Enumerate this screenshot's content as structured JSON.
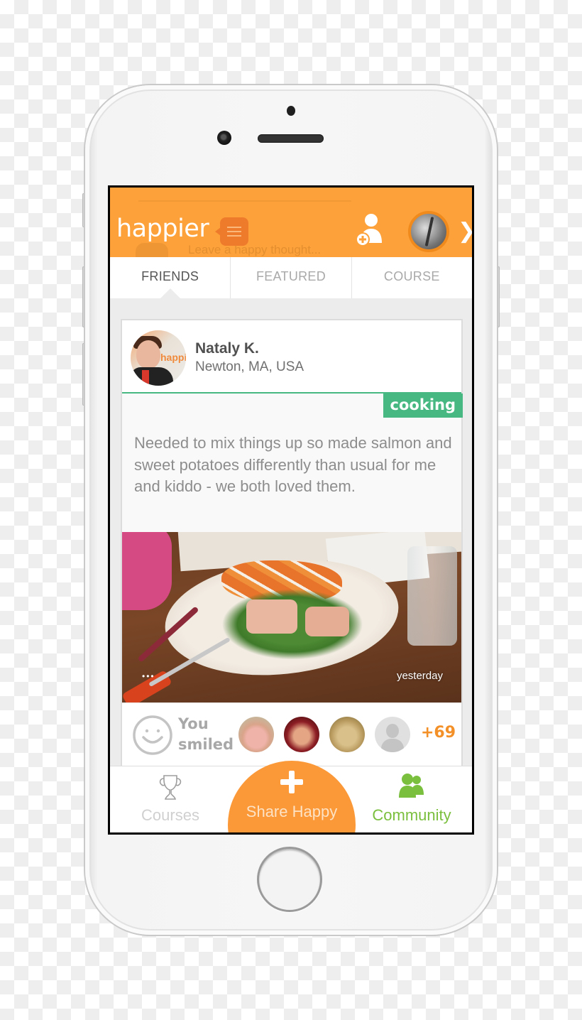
{
  "app": {
    "logo": "happier",
    "compose_placeholder": "Leave a happy thought...",
    "brand_color": "#fda23a",
    "accent_green": "#47b881",
    "community_green": "#7bbf3e"
  },
  "header": {
    "icons": {
      "menu": "menu-lines-icon",
      "add_friend": "add-friend-icon",
      "profile": "profile-avatar",
      "next": "chevron-right-icon"
    },
    "next_glyph": "❯"
  },
  "tabs": [
    {
      "label": "FRIENDS",
      "active": true
    },
    {
      "label": "FEATURED",
      "active": false
    },
    {
      "label": "COURSE",
      "active": false
    }
  ],
  "post": {
    "author": {
      "name": "Nataly K.",
      "location": "Newton, MA, USA",
      "avatar_brand_text": "happi"
    },
    "tag": "cooking",
    "text": "Needed to mix things up so made salmon and sweet potatoes differently than usual for me and kiddo - we both loved them.",
    "photo_alt": "salmon and sweet potatoes on a plate with arugula",
    "more_dots": "•••",
    "timestamp": "yesterday",
    "reactions": {
      "status_line1": "You",
      "status_line2": "smiled",
      "likers": [
        "friend-1",
        "friend-2",
        "friend-3",
        "friend-placeholder"
      ],
      "more_count": "+69"
    }
  },
  "bottom_nav": {
    "courses": {
      "label": "Courses",
      "icon": "trophy-icon"
    },
    "share": {
      "label": "Share Happy",
      "icon": "plus-icon"
    },
    "community": {
      "label": "Community",
      "icon": "community-icon",
      "active": true
    }
  }
}
